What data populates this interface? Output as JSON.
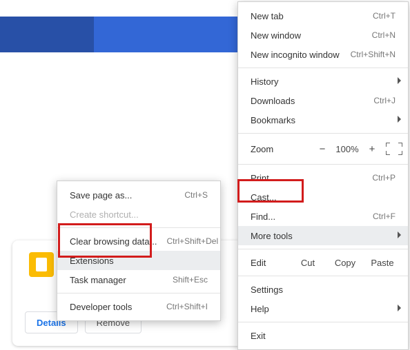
{
  "main": {
    "new_tab": "New tab",
    "sc_new_tab": "Ctrl+T",
    "new_win": "New window",
    "sc_new_win": "Ctrl+N",
    "inc": "New incognito window",
    "sc_inc": "Ctrl+Shift+N",
    "history": "History",
    "downloads": "Downloads",
    "sc_downloads": "Ctrl+J",
    "bookmarks": "Bookmarks",
    "zoom_lbl": "Zoom",
    "zoom_minus": "−",
    "zoom_val": "100%",
    "zoom_plus": "+",
    "print": "Print...",
    "sc_print": "Ctrl+P",
    "cast": "Cast...",
    "find": "Find...",
    "sc_find": "Ctrl+F",
    "more_tools": "More tools",
    "edit": "Edit",
    "cut": "Cut",
    "copy": "Copy",
    "paste": "Paste",
    "settings": "Settings",
    "help": "Help",
    "exit": "Exit"
  },
  "sub": {
    "save": "Save page as...",
    "sc_save": "Ctrl+S",
    "shortcut": "Create shortcut...",
    "clear": "Clear browsing data...",
    "sc_clear": "Ctrl+Shift+Del",
    "ext": "Extensions",
    "task": "Task manager",
    "sc_task": "Shift+Esc",
    "dev": "Developer tools",
    "sc_dev": "Ctrl+Shift+I"
  },
  "card": {
    "details": "Details",
    "remove": "Remove"
  }
}
